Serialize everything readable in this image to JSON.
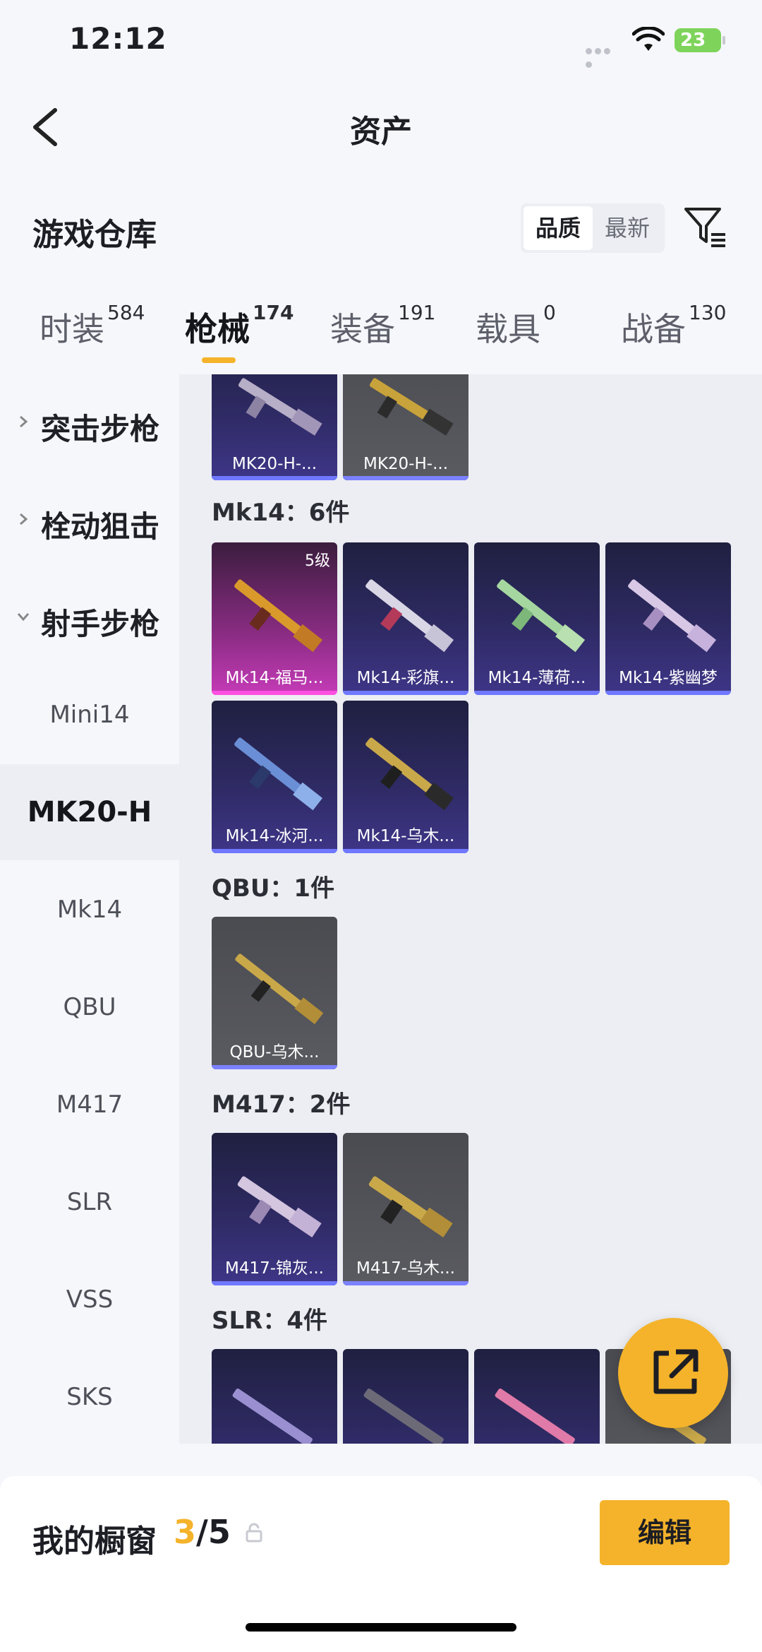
{
  "status": {
    "time": "12:12",
    "battery": "23"
  },
  "nav": {
    "title": "资产"
  },
  "header": {
    "title": "游戏仓库",
    "sort_quality": "品质",
    "sort_latest": "最新"
  },
  "tabs": [
    {
      "label": "时装",
      "count": "584"
    },
    {
      "label": "枪械",
      "count": "174"
    },
    {
      "label": "装备",
      "count": "191"
    },
    {
      "label": "载具",
      "count": "0"
    },
    {
      "label": "战备",
      "count": "130"
    }
  ],
  "sidebar": {
    "categories": [
      {
        "label": "突击步枪"
      },
      {
        "label": "栓动狙击"
      },
      {
        "label": "射手步枪"
      }
    ],
    "subitems": [
      {
        "label": "Mini14"
      },
      {
        "label": "MK20-H"
      },
      {
        "label": "Mk14"
      },
      {
        "label": "QBU"
      },
      {
        "label": "M417"
      },
      {
        "label": "SLR"
      },
      {
        "label": "VSS"
      },
      {
        "label": "SKS"
      }
    ]
  },
  "groups": {
    "mk20": {
      "items": [
        {
          "name": "MK20-H-..."
        },
        {
          "name": "MK20-H-..."
        }
      ]
    },
    "mk14": {
      "title": "Mk14：6件",
      "items": [
        {
          "name": "Mk14-福马...",
          "level": "5级"
        },
        {
          "name": "Mk14-彩旗..."
        },
        {
          "name": "Mk14-薄荷..."
        },
        {
          "name": "Mk14-紫幽梦"
        },
        {
          "name": "Mk14-冰河..."
        },
        {
          "name": "Mk14-乌木..."
        }
      ]
    },
    "qbu": {
      "title": "QBU：1件",
      "items": [
        {
          "name": "QBU-乌木..."
        }
      ]
    },
    "m417": {
      "title": "M417：2件",
      "items": [
        {
          "name": "M417-锦灰..."
        },
        {
          "name": "M417-乌木..."
        }
      ]
    },
    "slr": {
      "title": "SLR：4件"
    }
  },
  "bottom": {
    "title": "我的橱窗",
    "current": "3",
    "total": "/5",
    "edit": "编辑"
  }
}
